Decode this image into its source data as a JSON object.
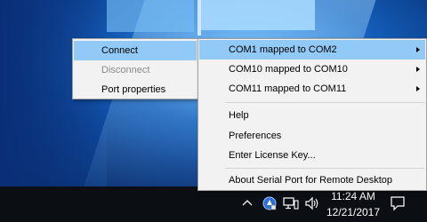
{
  "left_menu": {
    "items": [
      {
        "label": "Connect",
        "state": "highlighted"
      },
      {
        "label": "Disconnect",
        "state": "disabled"
      },
      {
        "label": "Port properties",
        "state": "normal"
      }
    ]
  },
  "right_menu": {
    "submenus": [
      {
        "label": "COM1 mapped to COM2"
      },
      {
        "label": "COM10 mapped to COM10"
      },
      {
        "label": "COM11 mapped to COM11"
      }
    ],
    "actions": [
      {
        "label": "Help"
      },
      {
        "label": "Preferences"
      },
      {
        "label": "Enter License Key..."
      }
    ],
    "about": {
      "label": "About Serial Port for Remote Desktop"
    }
  },
  "taskbar": {
    "time": "11:24 AM",
    "date": "12/21/2017"
  },
  "colors": {
    "highlight": "#91c9f7",
    "menu_bg": "#f2f2f2",
    "taskbar": "#0b0f14"
  },
  "icons": [
    "chevron-up-icon",
    "serial-port-app-icon",
    "network-icon",
    "volume-icon",
    "notification-icon",
    "submenu-arrow-icon"
  ]
}
